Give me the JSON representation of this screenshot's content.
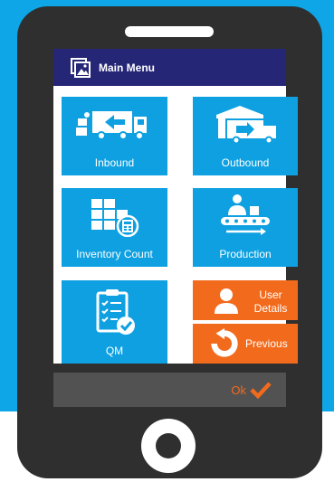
{
  "title_bar": {
    "title": "Main Menu",
    "icon": "image-gallery-icon"
  },
  "tiles": {
    "inbound": {
      "label": "Inbound",
      "icon": "truck-inbound-icon"
    },
    "outbound": {
      "label": "Outbound",
      "icon": "warehouse-outbound-icon"
    },
    "inventory": {
      "label": "Inventory Count",
      "icon": "boxes-calculator-icon"
    },
    "production": {
      "label": "Production",
      "icon": "conveyor-worker-icon"
    },
    "qm": {
      "label": "QM",
      "icon": "clipboard-check-icon"
    },
    "user_details": {
      "label_line1": "User",
      "label_line2": "Details",
      "icon": "user-icon"
    },
    "previous": {
      "label": "Previous",
      "icon": "back-arrow-icon"
    }
  },
  "footer": {
    "ok_label": "Ok",
    "icon": "check-icon"
  },
  "colors": {
    "blue": "#0ea0e0",
    "navy": "#262677",
    "orange": "#f26b1d",
    "frame": "#2f2f2f",
    "bar": "#525252"
  }
}
